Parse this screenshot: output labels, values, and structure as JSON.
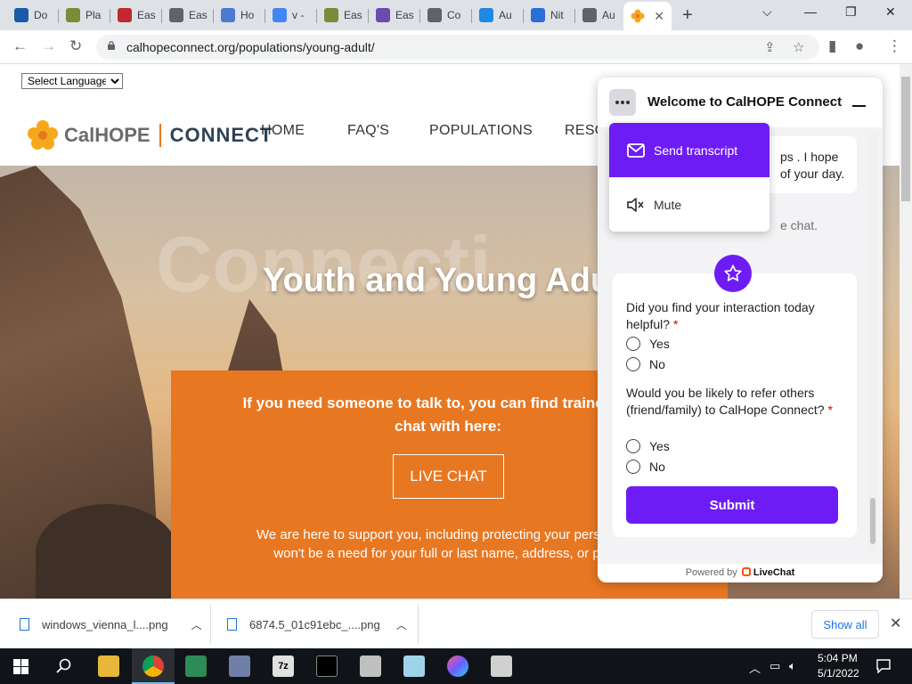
{
  "browser": {
    "tabs": [
      {
        "label": "Do",
        "color": "#1a5aa8"
      },
      {
        "label": "Pla",
        "color": "#7a8b3a"
      },
      {
        "label": "Eas",
        "color": "#c2282f"
      },
      {
        "label": "Eas",
        "color": "#5f6368"
      },
      {
        "label": "Ho",
        "color": "#4a7bd0"
      },
      {
        "label": "v -",
        "color": "#4285f4"
      },
      {
        "label": "Eas",
        "color": "#7a8b3a"
      },
      {
        "label": "Eas",
        "color": "#6a4caa"
      },
      {
        "label": "Co",
        "color": "#5f6368"
      },
      {
        "label": "Au",
        "color": "#1e88e5"
      },
      {
        "label": "Nit",
        "color": "#2a6fd8"
      },
      {
        "label": "Au",
        "color": "#5f6368"
      }
    ],
    "url": "calhopeconnect.org/populations/young-adult/"
  },
  "site": {
    "language_select": "Select Language",
    "logo_part1": "CalHOPE",
    "logo_part2": "CONNECT",
    "nav": [
      "HOME",
      "FAQ'S",
      "POPULATIONS",
      "RESO"
    ],
    "hero_ghost": "Connecti",
    "hero_title": "Youth and Young Adu",
    "box_text1_line1": "If you need someone to talk to, you can find trained supp",
    "box_text1_line2": "chat with here:",
    "live_chat": "LIVE CHAT",
    "box_text2_line1": "We are here to support you, including protecting your personal in",
    "box_text2_line2": "won't be a need for your full or last name, address, or phon"
  },
  "chat": {
    "title": "Welcome to CalHOPE Connect",
    "menu": {
      "send_transcript": "Send transcript",
      "mute": "Mute"
    },
    "message_line1": "ps . I hope",
    "message_line2": "of your day.",
    "system_note": "e chat.",
    "survey": {
      "q1": "Did you find your interaction today helpful?",
      "q2": "Would you be likely to refer others (friend/family) to CalHope Connect?",
      "required": "*",
      "yes": "Yes",
      "no": "No",
      "submit": "Submit"
    },
    "powered_by": "Powered by",
    "brand": "LiveChat",
    "accent": "#6d1cf6"
  },
  "downloads": {
    "file1": "windows_vienna_l....png",
    "file2": "6874.5_01c91ebc_....png",
    "show_all": "Show all"
  },
  "taskbar": {
    "time": "5:04 PM",
    "date": "5/1/2022"
  }
}
